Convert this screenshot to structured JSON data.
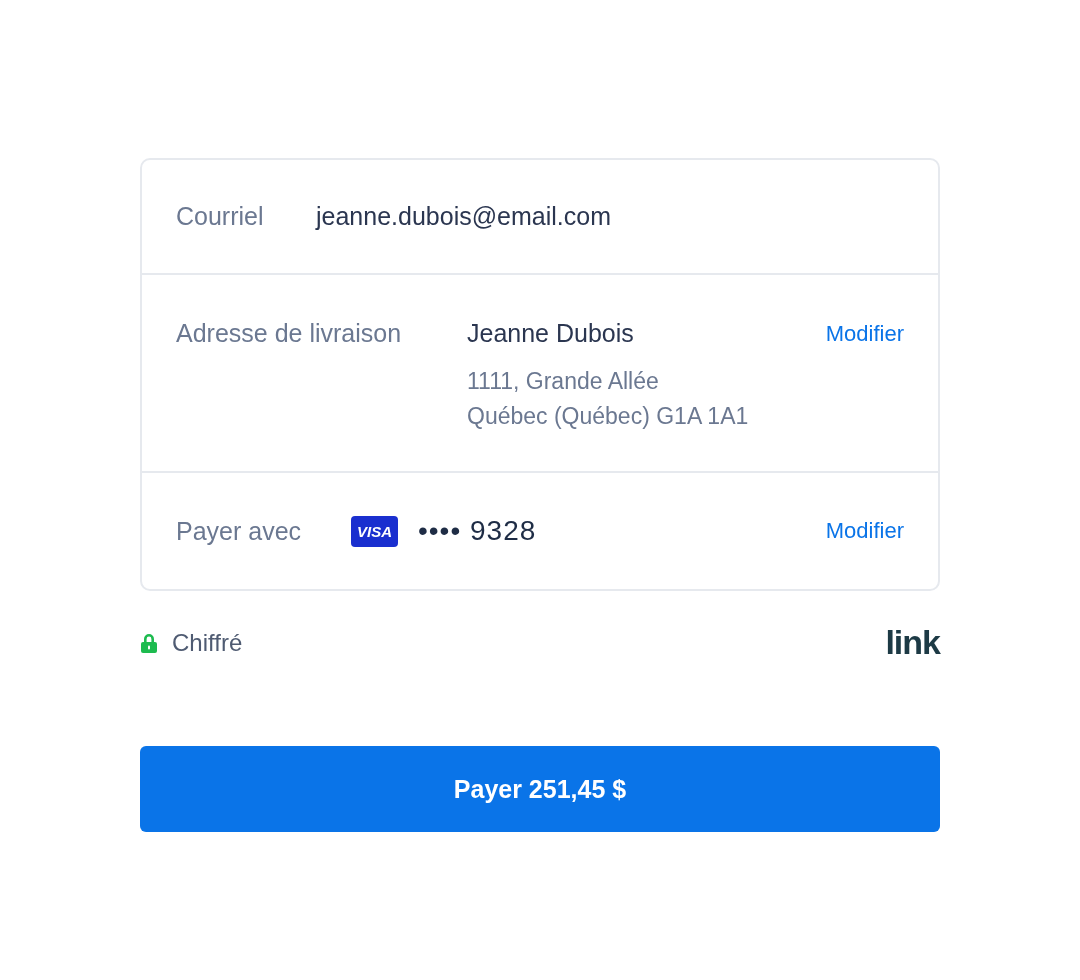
{
  "email": {
    "label": "Courriel",
    "value": "jeanne.dubois@email.com"
  },
  "shipping": {
    "label": "Adresse de livraison",
    "name": "Jeanne Dubois",
    "address_lines": [
      "1111, Grande Allée",
      "Québec (Québec) G1A 1A1"
    ],
    "action": "Modifier"
  },
  "payment": {
    "label": "Payer avec",
    "card_brand": "VISA",
    "masked": "•••• 9328",
    "action": "Modifier"
  },
  "security": {
    "label": "Chiffré"
  },
  "logo": "link",
  "pay_button": "Payer 251,45 $"
}
